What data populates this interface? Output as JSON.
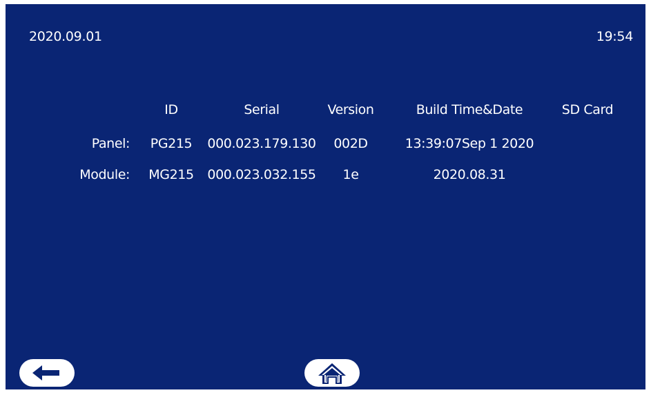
{
  "status": {
    "date": "2020.09.01",
    "time": "19:54"
  },
  "table": {
    "headers": {
      "id": "ID",
      "serial": "Serial",
      "version": "Version",
      "build": "Build Time&Date",
      "sd": "SD Card"
    },
    "rows": [
      {
        "label": "Panel:",
        "id": "PG215",
        "serial": "000.023.179.130",
        "version": "002D",
        "build": "13:39:07Sep 1 2020",
        "sd": ""
      },
      {
        "label": "Module:",
        "id": "MG215",
        "serial": "000.023.032.155",
        "version": "1e",
        "build": "2020.08.31",
        "sd": ""
      }
    ]
  },
  "icons": {
    "back": "arrow-left-icon",
    "home": "home-icon"
  },
  "colors": {
    "background": "#0a2574",
    "text": "#ffffff",
    "button": "#ffffff"
  }
}
